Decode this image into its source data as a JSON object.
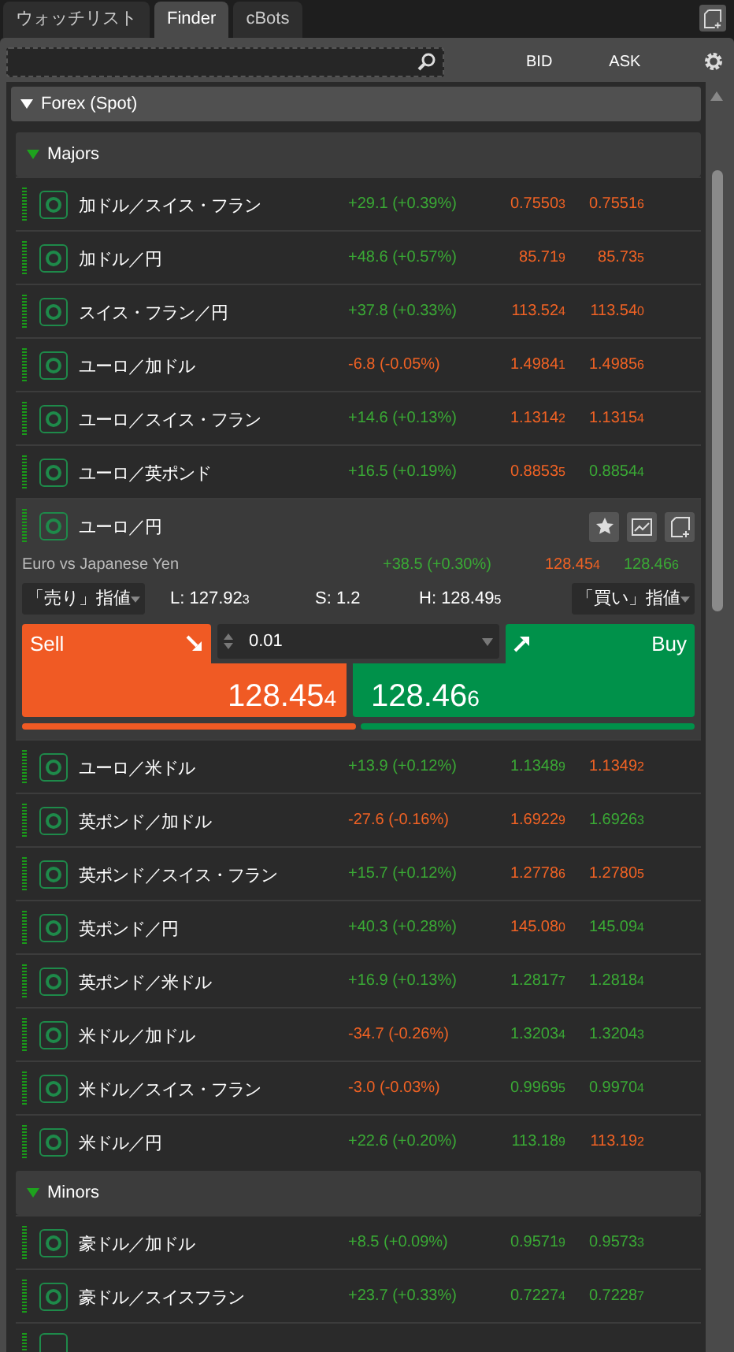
{
  "tabs": [
    {
      "label": "ウォッチリスト",
      "selected": false
    },
    {
      "label": "Finder",
      "selected": true
    },
    {
      "label": "cBots",
      "selected": false
    }
  ],
  "columns": [
    "BID",
    "ASK"
  ],
  "groups": [
    {
      "label": "Forex (Spot)",
      "expanded": true,
      "subgroups": [
        {
          "label": "Majors",
          "expanded": true,
          "rows": [
            {
              "kind": "row",
              "name": "加ドル／スイス・フラン",
              "change": "+29.1 (+0.39%)",
              "change_up": true,
              "bid": {
                "main": "0.7550",
                "pip": "3",
                "up": false
              },
              "ask": {
                "main": "0.7551",
                "pip": "6",
                "up": false
              }
            },
            {
              "kind": "row",
              "name": "加ドル／円",
              "change": "+48.6 (+0.57%)",
              "change_up": true,
              "bid": {
                "main": "85.71",
                "pip": "9",
                "up": false
              },
              "ask": {
                "main": "85.73",
                "pip": "5",
                "up": false
              }
            },
            {
              "kind": "row",
              "name": "スイス・フラン／円",
              "change": "+37.8 (+0.33%)",
              "change_up": true,
              "bid": {
                "main": "113.52",
                "pip": "4",
                "up": false
              },
              "ask": {
                "main": "113.54",
                "pip": "0",
                "up": false
              }
            },
            {
              "kind": "row",
              "name": "ユーロ／加ドル",
              "change": "-6.8 (-0.05%)",
              "change_up": false,
              "bid": {
                "main": "1.4984",
                "pip": "1",
                "up": false
              },
              "ask": {
                "main": "1.4985",
                "pip": "6",
                "up": false
              }
            },
            {
              "kind": "row",
              "name": "ユーロ／スイス・フラン",
              "change": "+14.6 (+0.13%)",
              "change_up": true,
              "bid": {
                "main": "1.1314",
                "pip": "2",
                "up": false
              },
              "ask": {
                "main": "1.1315",
                "pip": "4",
                "up": false
              }
            },
            {
              "kind": "row",
              "name": "ユーロ／英ポンド",
              "change": "+16.5 (+0.19%)",
              "change_up": true,
              "bid": {
                "main": "0.8853",
                "pip": "5",
                "up": false
              },
              "ask": {
                "main": "0.8854",
                "pip": "4",
                "up": true
              }
            },
            {
              "kind": "expanded",
              "name": "ユーロ／円",
              "description": "Euro vs Japanese Yen",
              "change": "+38.5 (+0.30%)",
              "change_up": true,
              "bid": {
                "main": "128.45",
                "pip": "4",
                "up": false
              },
              "ask": {
                "main": "128.46",
                "pip": "6",
                "up": true
              },
              "sell_order": "「売り」指値",
              "low": {
                "label": "L:",
                "main": "127.92",
                "pip": "3"
              },
              "spread": "S: 1.2",
              "high": {
                "label": "H:",
                "main": "128.49",
                "pip": "5"
              },
              "buy_order": "「買い」指値",
              "sell_label": "Sell",
              "buy_label": "Buy",
              "quantity": "0.01",
              "sell_price": {
                "main": "128.45",
                "pip": "4"
              },
              "buy_price": {
                "main": "128.46",
                "pip": "6"
              }
            },
            {
              "kind": "row",
              "name": "ユーロ／米ドル",
              "change": "+13.9 (+0.12%)",
              "change_up": true,
              "bid": {
                "main": "1.1348",
                "pip": "9",
                "up": true
              },
              "ask": {
                "main": "1.1349",
                "pip": "2",
                "up": false
              }
            },
            {
              "kind": "row",
              "name": "英ポンド／加ドル",
              "change": "-27.6 (-0.16%)",
              "change_up": false,
              "bid": {
                "main": "1.6922",
                "pip": "9",
                "up": false
              },
              "ask": {
                "main": "1.6926",
                "pip": "3",
                "up": true
              }
            },
            {
              "kind": "row",
              "name": "英ポンド／スイス・フラン",
              "change": "+15.7 (+0.12%)",
              "change_up": true,
              "bid": {
                "main": "1.2778",
                "pip": "6",
                "up": false
              },
              "ask": {
                "main": "1.2780",
                "pip": "5",
                "up": false
              }
            },
            {
              "kind": "row",
              "name": "英ポンド／円",
              "change": "+40.3 (+0.28%)",
              "change_up": true,
              "bid": {
                "main": "145.08",
                "pip": "0",
                "up": false
              },
              "ask": {
                "main": "145.09",
                "pip": "4",
                "up": true
              }
            },
            {
              "kind": "row",
              "name": "英ポンド／米ドル",
              "change": "+16.9 (+0.13%)",
              "change_up": true,
              "bid": {
                "main": "1.2817",
                "pip": "7",
                "up": true
              },
              "ask": {
                "main": "1.2818",
                "pip": "4",
                "up": true
              }
            },
            {
              "kind": "row",
              "name": "米ドル／加ドル",
              "change": "-34.7 (-0.26%)",
              "change_up": false,
              "bid": {
                "main": "1.3203",
                "pip": "4",
                "up": true
              },
              "ask": {
                "main": "1.3204",
                "pip": "3",
                "up": true
              }
            },
            {
              "kind": "row",
              "name": "米ドル／スイス・フラン",
              "change": "-3.0 (-0.03%)",
              "change_up": false,
              "bid": {
                "main": "0.9969",
                "pip": "5",
                "up": true
              },
              "ask": {
                "main": "0.9970",
                "pip": "4",
                "up": true
              }
            },
            {
              "kind": "row",
              "name": "米ドル／円",
              "change": "+22.6 (+0.20%)",
              "change_up": true,
              "bid": {
                "main": "113.18",
                "pip": "9",
                "up": true
              },
              "ask": {
                "main": "113.19",
                "pip": "2",
                "up": false
              }
            }
          ]
        },
        {
          "label": "Minors",
          "expanded": true,
          "rows": [
            {
              "kind": "row",
              "name": "豪ドル／加ドル",
              "change": "+8.5 (+0.09%)",
              "change_up": true,
              "bid": {
                "main": "0.9571",
                "pip": "9",
                "up": true
              },
              "ask": {
                "main": "0.9573",
                "pip": "3",
                "up": true
              }
            },
            {
              "kind": "row",
              "name": "豪ドル／スイスフラン",
              "change": "+23.7 (+0.33%)",
              "change_up": true,
              "bid": {
                "main": "0.7227",
                "pip": "4",
                "up": true
              },
              "ask": {
                "main": "0.7228",
                "pip": "7",
                "up": true
              }
            },
            {
              "kind": "stub"
            }
          ]
        }
      ]
    }
  ]
}
